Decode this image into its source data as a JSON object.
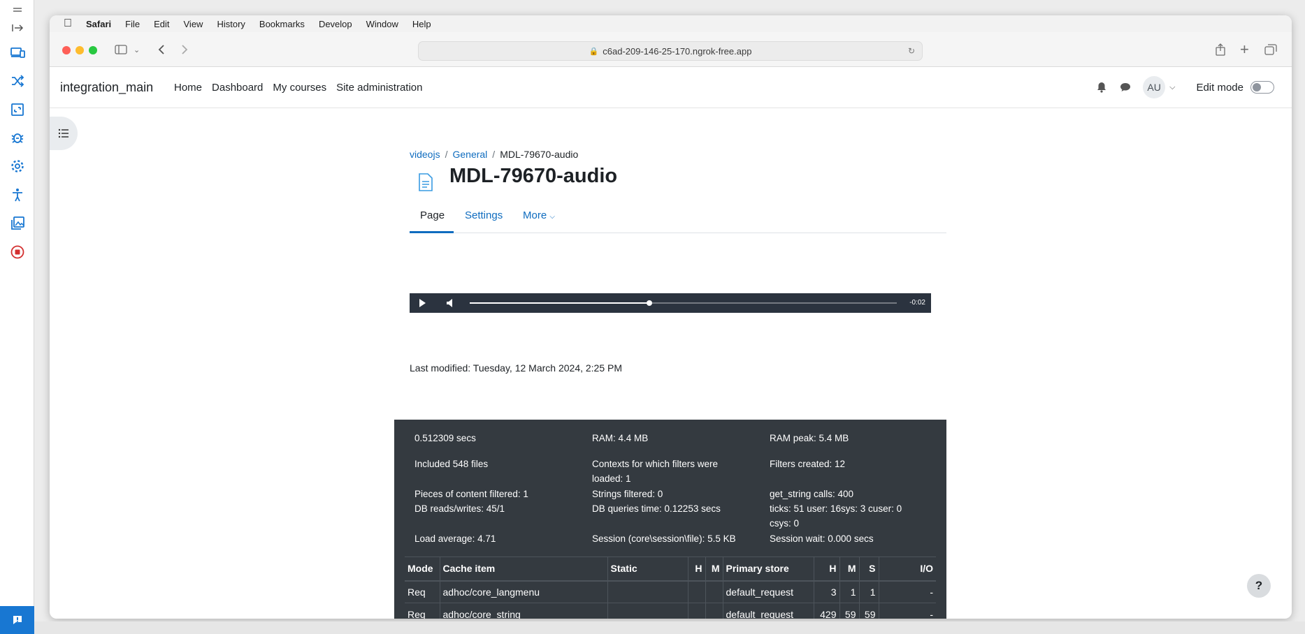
{
  "tools": {
    "items": [
      "menu-icon",
      "expand-icon",
      "devices-icon",
      "shuffle-icon",
      "screenshot-icon",
      "bug-icon",
      "settings-icon",
      "accessibility-icon",
      "gallery-icon",
      "record-icon",
      "feedback-icon"
    ],
    "accent": "#1877d2"
  },
  "menubar": {
    "app": "Safari",
    "items": [
      "File",
      "Edit",
      "View",
      "History",
      "Bookmarks",
      "Develop",
      "Window",
      "Help"
    ]
  },
  "toolbar": {
    "url": "c6ad-209-146-25-170.ngrok-free.app"
  },
  "navbar": {
    "site_name": "integration_main",
    "links": [
      "Home",
      "Dashboard",
      "My courses",
      "Site administration"
    ],
    "avatar_initials": "AU",
    "edit_mode_label": "Edit mode",
    "edit_mode_on": false
  },
  "breadcrumb": {
    "items": [
      "videojs",
      "General",
      "MDL-79670-audio"
    ]
  },
  "page": {
    "title": "MDL-79670-audio",
    "tabs": [
      "Page",
      "Settings",
      "More"
    ],
    "active_tab": "Page",
    "last_modified": "Last modified: Tuesday, 12 March 2024, 2:25 PM"
  },
  "player": {
    "time_remaining": "-0:02",
    "progress": 0.42
  },
  "perf": {
    "items": [
      "0.512309 secs",
      "RAM: 4.4 MB",
      "RAM peak: 5.4 MB",
      "Included 548 files",
      "Contexts for which filters were loaded: 1",
      "Filters created: 12",
      "Pieces of content filtered: 1",
      "Strings filtered: 0",
      "get_string calls: 400",
      "DB reads/writes: 45/1",
      "DB queries time: 0.12253 secs",
      "ticks: 51 user: 16sys: 3 cuser: 0 csys: 0",
      "Load average: 4.71",
      "Session (core\\session\\file): 5.5 KB",
      "Session wait: 0.000 secs"
    ],
    "table": {
      "headers": [
        "Mode",
        "Cache item",
        "Static",
        "H",
        "M",
        "Primary store",
        "H",
        "M",
        "S",
        "I/O"
      ],
      "rows": [
        [
          "Req",
          "adhoc/core_langmenu",
          "",
          "",
          "",
          "default_request",
          "3",
          "1",
          "1",
          "-"
        ],
        [
          "Req",
          "adhoc/core_string",
          "",
          "",
          "",
          "default_request",
          "429",
          "59",
          "59",
          "-"
        ]
      ]
    }
  },
  "help_label": "?"
}
